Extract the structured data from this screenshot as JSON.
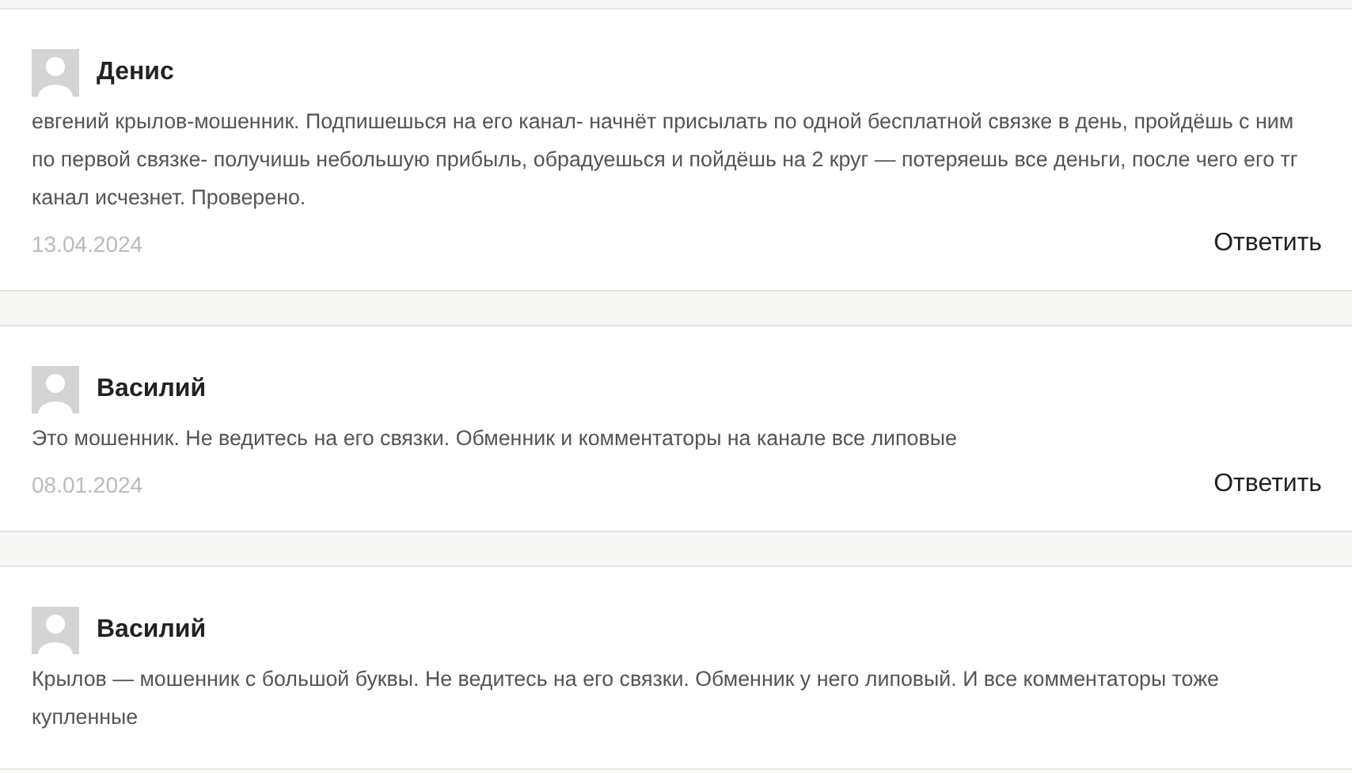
{
  "comments": [
    {
      "author": "Денис",
      "text": "евгений крылов-мошенник. Подпишешься на его канал- начнёт присылать по одной бесплатной связке в день, пройдёшь с ним по первой связке- получишь небольшую прибыль, обрадуешься и пойдёшь на 2 круг — потеряешь все деньги, после чего его тг канал исчезнет. Проверено.",
      "date": "13.04.2024",
      "reply": "Ответить"
    },
    {
      "author": "Василий",
      "text": "Это мошенник. Не ведитесь на его связки. Обменник и комментаторы на канале все липовые",
      "date": "08.01.2024",
      "reply": "Ответить"
    },
    {
      "author": "Василий",
      "text": "Крылов — мошенник с большой буквы. Не ведитесь на его связки. Обменник у него липовый. И все комментаторы тоже купленные"
    }
  ]
}
